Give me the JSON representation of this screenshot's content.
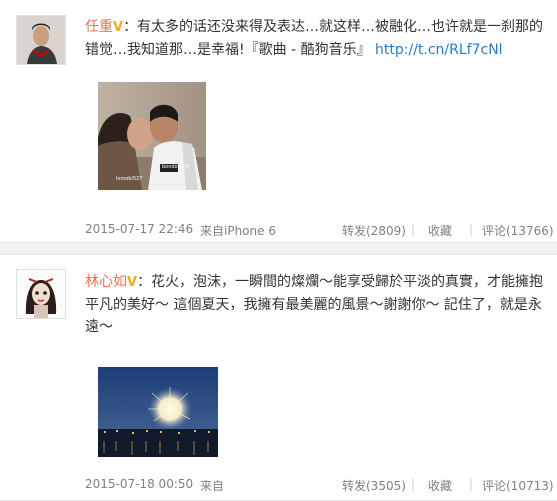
{
  "posts": [
    {
      "user": "任重",
      "text_before_link": "：有太多的话还没来得及表达…就这样…被融化…也许就是一刹那的错觉…我知道那…是幸福!『歌曲 - 酷狗音乐』 ",
      "link": "http://t.cn/RLf7cNl",
      "image_caption_left": "lomobi527",
      "image_caption_right": "bondoff.58",
      "time": "2015-07-17 22:46",
      "source": "来自iPhone 6",
      "repost": "转发(2809)",
      "favorite": "收藏",
      "comment": "评论(13766)"
    },
    {
      "user": "林心如",
      "text_before_link": "：花火，泡沫，一瞬間的燦爛～能享受歸於平淡的真實，才能擁抱平凡的美好～ 這個夏天，我擁有最美麗的風景～謝謝你～ 記住了，就是永遠～",
      "time": "2015-07-18 00:50",
      "source": "来自",
      "repost": "转发(3505)",
      "favorite": "收藏",
      "comment": "评论(10713)"
    }
  ],
  "colors": {
    "name": "#eb7350",
    "link": "#2f7ac0",
    "meta": "#808080",
    "badge": "#f4a823"
  }
}
